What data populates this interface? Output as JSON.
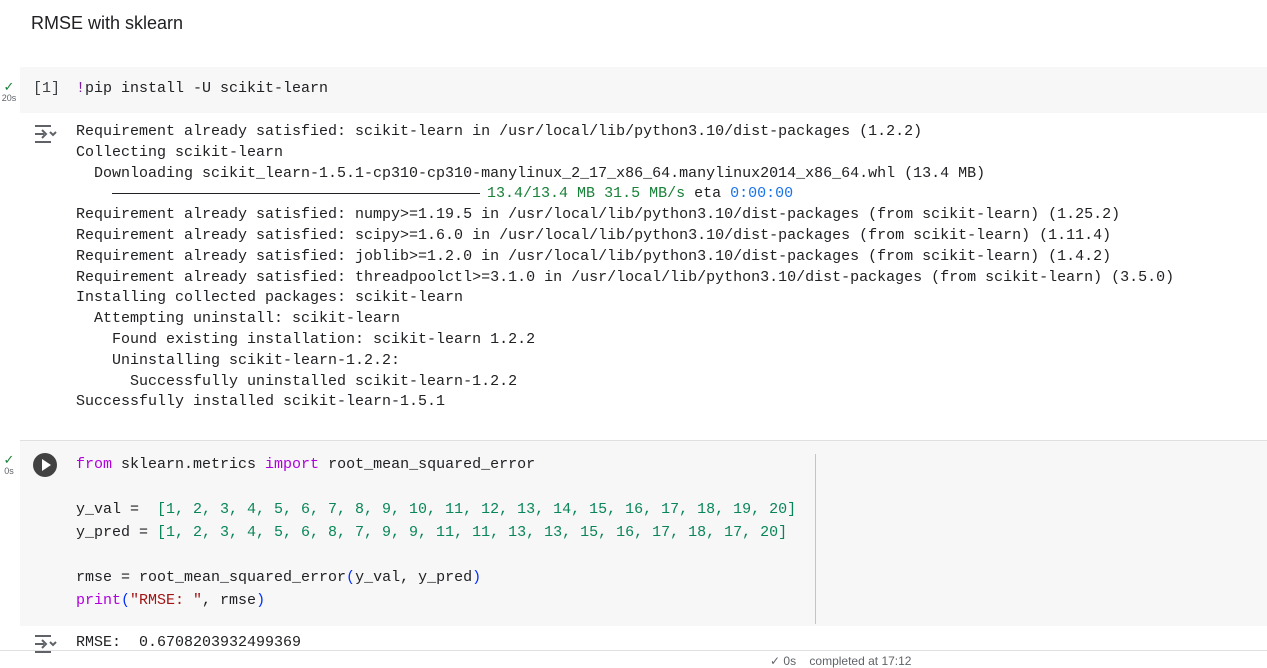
{
  "heading": "RMSE with sklearn",
  "cell1": {
    "status": "20s",
    "exec_count": "[1]",
    "code_bang": "!",
    "code_rest": "pip install -U scikit-learn",
    "output": {
      "line1": "Requirement already satisfied: scikit-learn in /usr/local/lib/python3.10/dist-packages (1.2.2)",
      "line2": "Collecting scikit-learn",
      "line3": "  Downloading scikit_learn-1.5.1-cp310-cp310-manylinux_2_17_x86_64.manylinux2014_x86_64.whl (13.4 MB)",
      "progress": {
        "fraction": 1.0,
        "size": "13.4/13.4 MB",
        "speed": "31.5 MB/s",
        "eta_label": "eta",
        "eta": "0:00:00"
      },
      "line5": "Requirement already satisfied: numpy>=1.19.5 in /usr/local/lib/python3.10/dist-packages (from scikit-learn) (1.25.2)",
      "line6": "Requirement already satisfied: scipy>=1.6.0 in /usr/local/lib/python3.10/dist-packages (from scikit-learn) (1.11.4)",
      "line7": "Requirement already satisfied: joblib>=1.2.0 in /usr/local/lib/python3.10/dist-packages (from scikit-learn) (1.4.2)",
      "line8": "Requirement already satisfied: threadpoolctl>=3.1.0 in /usr/local/lib/python3.10/dist-packages (from scikit-learn) (3.5.0)",
      "line9": "Installing collected packages: scikit-learn",
      "line10": "  Attempting uninstall: scikit-learn",
      "line11": "    Found existing installation: scikit-learn 1.2.2",
      "line12": "    Uninstalling scikit-learn-1.2.2:",
      "line13": "      Successfully uninstalled scikit-learn-1.2.2",
      "line14": "Successfully installed scikit-learn-1.5.1"
    }
  },
  "cell2": {
    "status": "0s",
    "code": {
      "l1_from": "from",
      "l1_mod": " sklearn.metrics ",
      "l1_import": "import",
      "l1_name": " root_mean_squared_error",
      "l3_var": "y_val =  ",
      "l3_list": "[1, 2, 3, 4, 5, 6, 7, 8, 9, 10, 11, 12, 13, 14, 15, 16, 17, 18, 19, 20]",
      "l4_var": "y_pred = ",
      "l4_list": "[1, 2, 3, 4, 5, 6, 8, 7, 9, 9, 11, 11, 13, 13, 15, 16, 17, 18, 17, 20]",
      "l6_a": "rmse = root_mean_squared_error",
      "l6_open": "(",
      "l6_args": "y_val, y_pred",
      "l6_close": ")",
      "l7_print": "print",
      "l7_open": "(",
      "l7_str": "\"RMSE: \"",
      "l7_rest": ", rmse",
      "l7_close": ")"
    },
    "output": "RMSE:  0.6708203932499369"
  },
  "statusbar": "✓ 0s    completed at 17:12",
  "colors": {
    "success": "#188038",
    "cell_bg": "#f7f7f7",
    "keyword": "#af00db",
    "number": "#098658"
  }
}
